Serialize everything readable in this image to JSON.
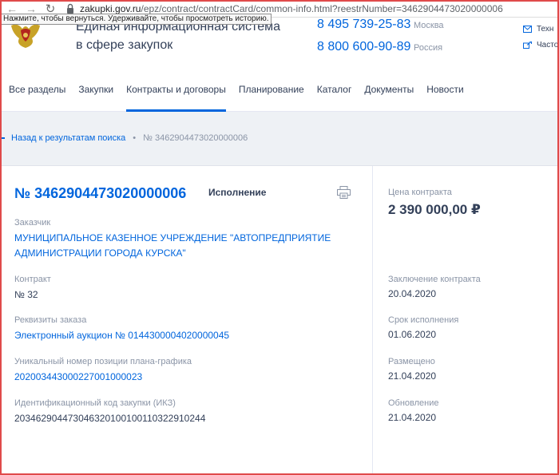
{
  "browser": {
    "url_host": "zakupki.gov.ru",
    "url_path": "/epz/contract/contractCard/common-info.html?reestrNumber=3462904473020000006",
    "tooltip": "Нажмите, чтобы вернуться. Удерживайте, чтобы просмотреть историю."
  },
  "header": {
    "title_line1": "Единая информационная система",
    "title_line2": "в сфере закупок",
    "phones": [
      {
        "number": "8 495 739-25-83",
        "city": "Москва"
      },
      {
        "number": "8 800 600-90-89",
        "city": "Россия"
      }
    ],
    "side_links": [
      "Техн",
      "Часто"
    ]
  },
  "nav": {
    "items": [
      "Все разделы",
      "Закупки",
      "Контракты и договоры",
      "Планирование",
      "Каталог",
      "Документы",
      "Новости"
    ],
    "active_index": 2
  },
  "breadcrumb": {
    "back": "Назад к результатам поиска",
    "current": "№ 3462904473020000006"
  },
  "card": {
    "number": "№ 3462904473020000006",
    "status": "Исполнение",
    "customer_label": "Заказчик",
    "customer_line1": "МУНИЦИПАЛЬНОЕ КАЗЕННОЕ УЧРЕЖДЕНИЕ \"АВТОПРЕДПРИЯТИЕ",
    "customer_line2": "АДМИНИСТРАЦИИ ГОРОДА КУРСКА\"",
    "contract_label": "Контракт",
    "contract_value": "№ 32",
    "order_label": "Реквизиты заказа",
    "order_value": "Электронный аукцион № 0144300004020000045",
    "plan_label": "Уникальный номер позиции плана-графика",
    "plan_value": "202003443000227001000023",
    "ikz_label": "Идентификационный код закупки (ИКЗ)",
    "ikz_value": "203462904473046320100100110322910244"
  },
  "right": {
    "price_label": "Цена контракта",
    "price_value": "2 390 000,00 ₽",
    "conclusion_label": "Заключение контракта",
    "conclusion_value": "20.04.2020",
    "term_label": "Срок исполнения",
    "term_value": "01.06.2020",
    "posted_label": "Размещено",
    "posted_value": "21.04.2020",
    "updated_label": "Обновление",
    "updated_value": "21.04.2020"
  },
  "colors": {
    "accent": "#0065dd",
    "text": "#334059",
    "muted": "#8a94a6",
    "band": "#eef1f5",
    "frame": "#e04a4a"
  }
}
